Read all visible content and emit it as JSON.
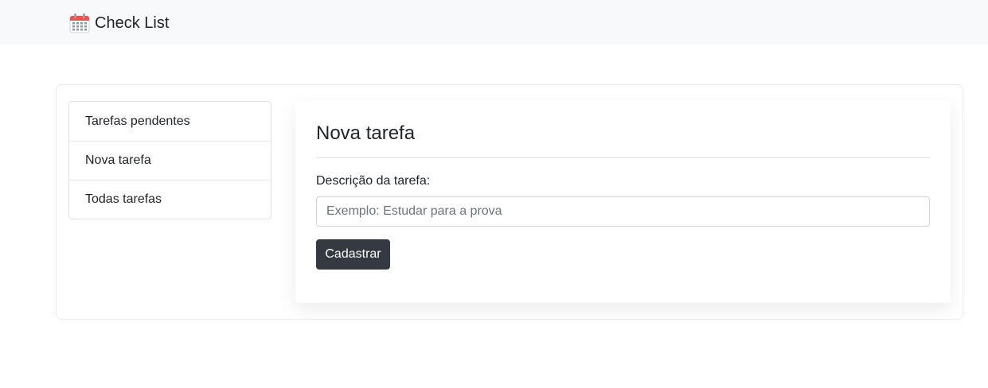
{
  "navbar": {
    "brand_icon": "calendar-icon",
    "brand_text": "Check List"
  },
  "sidebar": {
    "items": [
      {
        "label": "Tarefas pendentes"
      },
      {
        "label": "Nova tarefa"
      },
      {
        "label": "Todas tarefas"
      }
    ]
  },
  "form": {
    "title": "Nova tarefa",
    "label": "Descrição da tarefa:",
    "input_value": "",
    "input_placeholder": "Exemplo: Estudar para a prova",
    "submit_label": "Cadastrar"
  },
  "colors": {
    "navbar_bg": "#f8f9fa",
    "button_bg": "#343a40",
    "button_text": "#ffffff",
    "text": "#212529",
    "placeholder": "#6c757d"
  }
}
